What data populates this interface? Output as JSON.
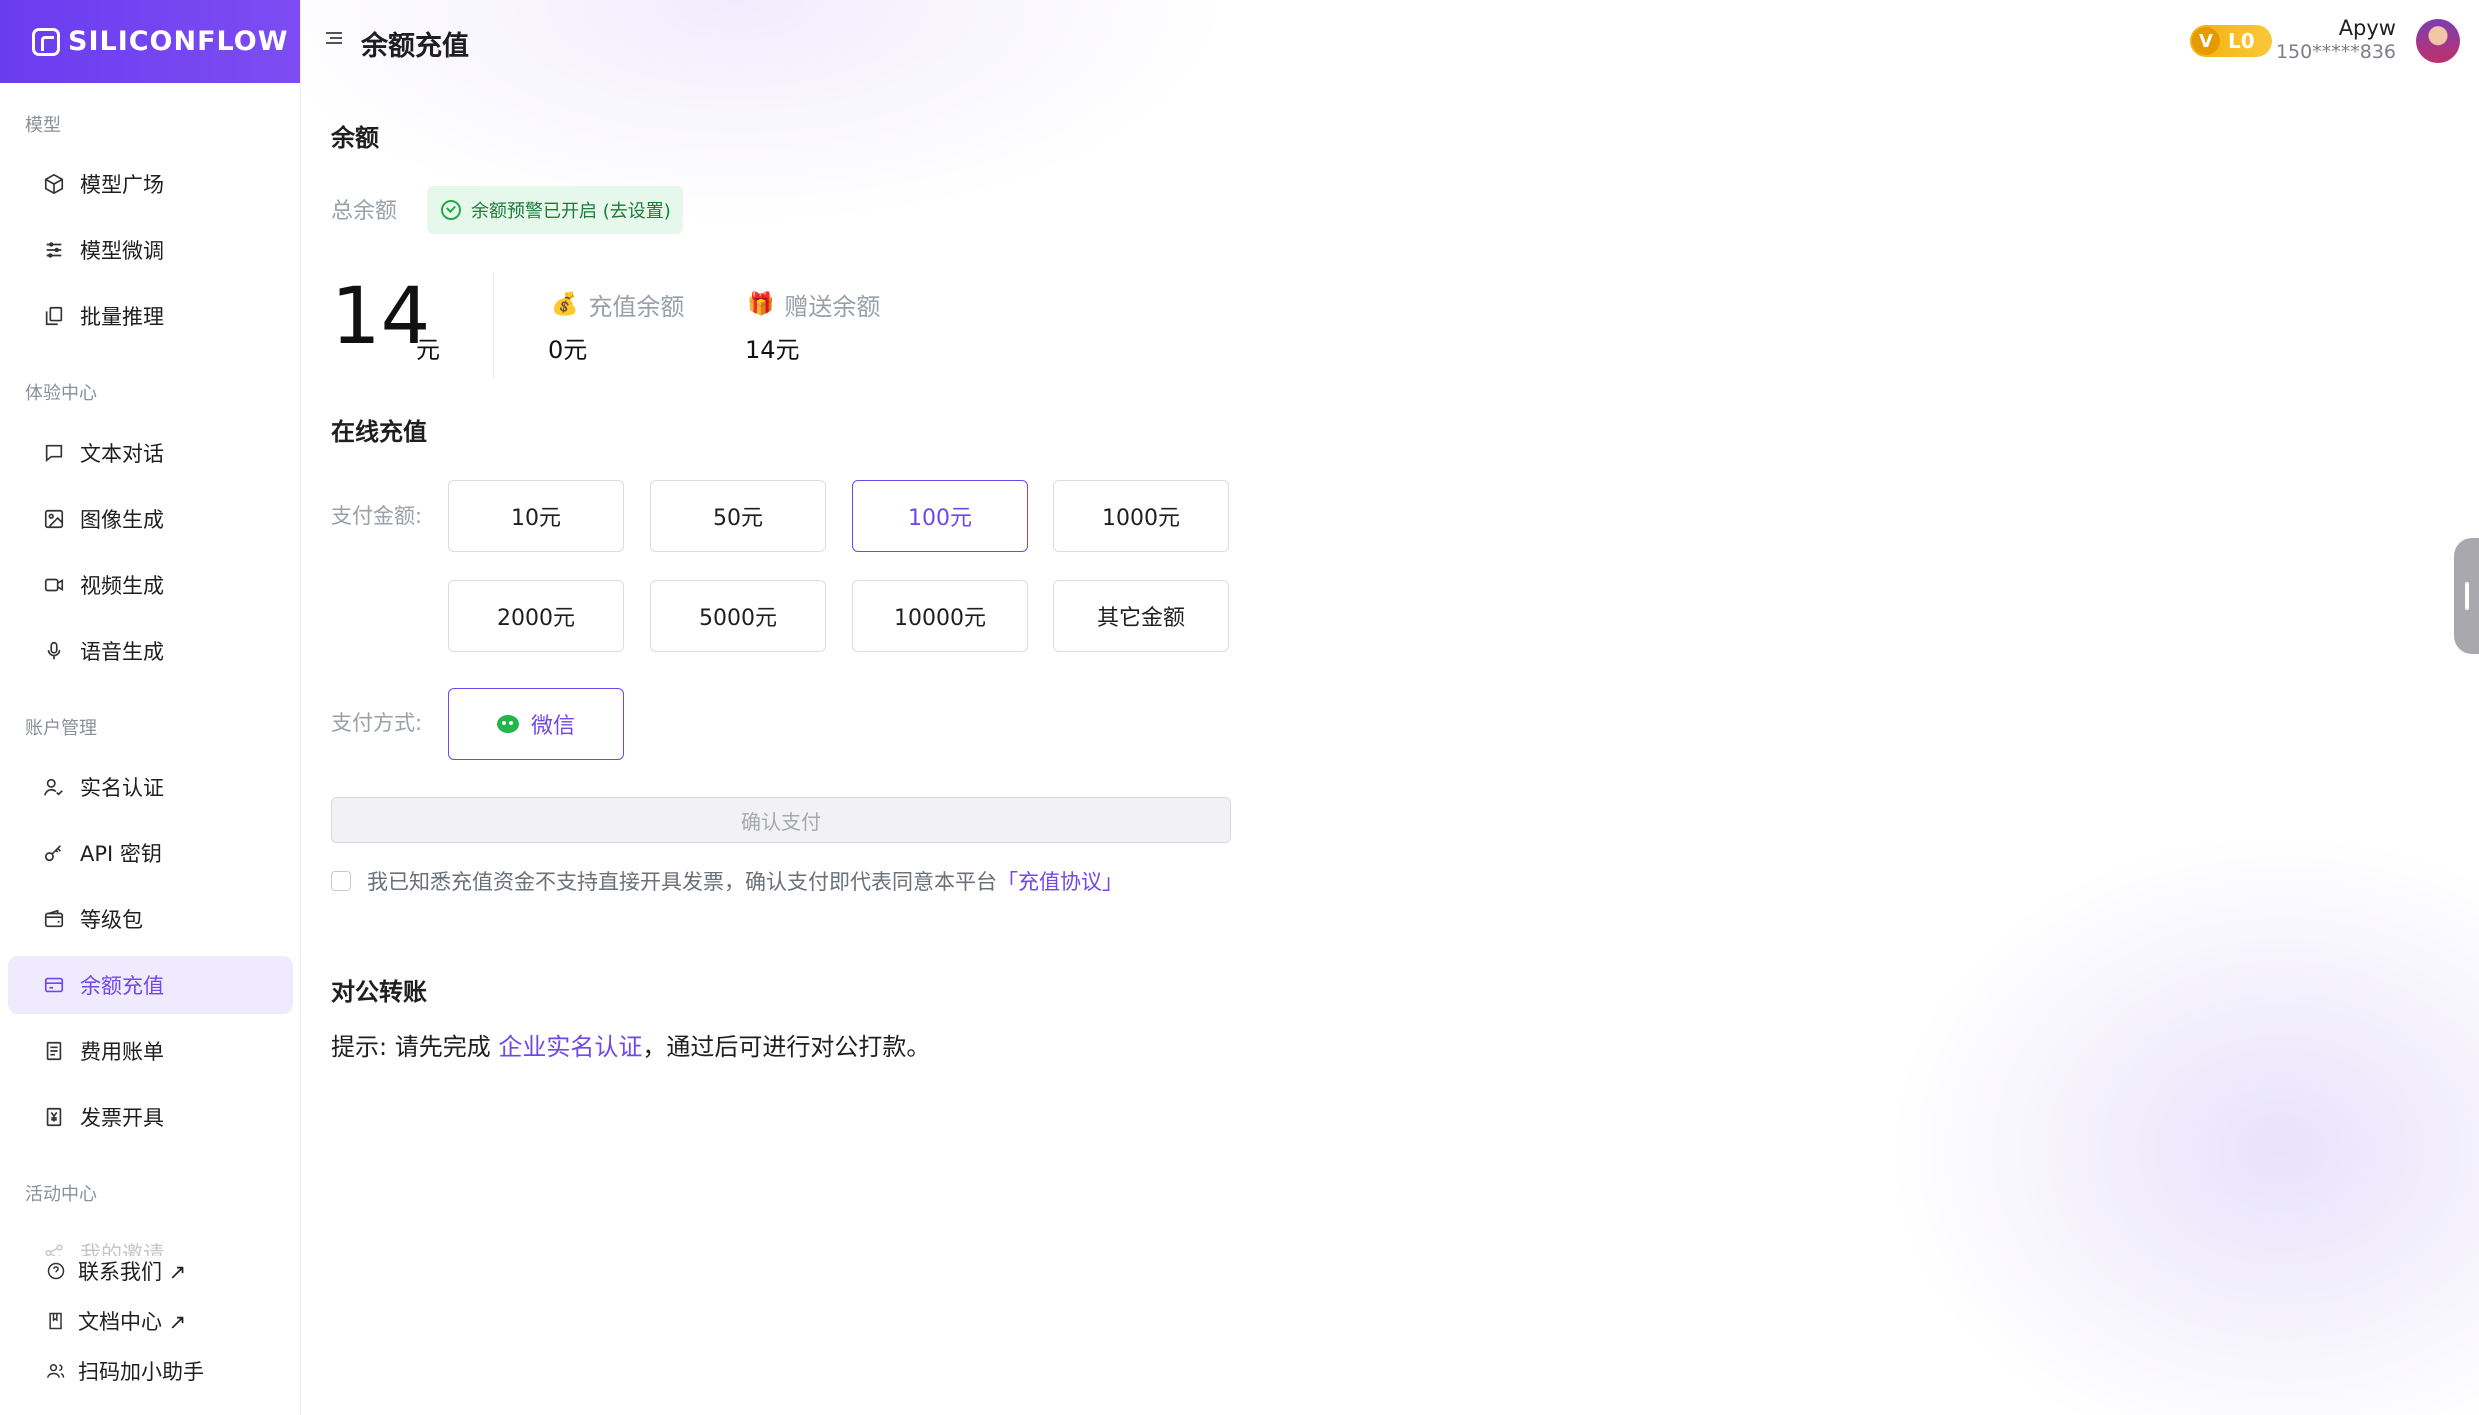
{
  "sidebar": {
    "logo_text": "SILICONFLOW",
    "sections": {
      "model": "模型",
      "experience": "体验中心",
      "account": "账户管理",
      "activity": "活动中心"
    },
    "items": {
      "model_square": "模型广场",
      "model_finetune": "模型微调",
      "batch_inference": "批量推理",
      "text_chat": "文本对话",
      "image_gen": "图像生成",
      "video_gen": "视频生成",
      "voice_gen": "语音生成",
      "realname": "实名认证",
      "api_key": "API 密钥",
      "level_pack": "等级包",
      "recharge": "余额充值",
      "billing": "费用账单",
      "invoice": "发票开具",
      "my_invite": "我的邀请"
    },
    "bottom": {
      "contact": "联系我们 ↗",
      "docs": "文档中心 ↗",
      "assistant": "扫码加小助手"
    }
  },
  "header": {
    "title": "余额充值",
    "badge_icon": "V",
    "level": "L0",
    "username": "Apyw",
    "phone": "150*****836"
  },
  "balance": {
    "section_title": "余额",
    "total_label": "总余额",
    "alert_text": "余额预警已开启 (去设置)",
    "total_value": "14",
    "total_unit": "元",
    "recharge_label": "充值余额",
    "recharge_value": "0元",
    "gift_label": "赠送余额",
    "gift_value": "14元"
  },
  "online": {
    "section_title": "在线充值",
    "amount_label": "支付金额:",
    "amounts": [
      "10元",
      "50元",
      "100元",
      "1000元",
      "2000元",
      "5000元",
      "10000元",
      "其它金额"
    ],
    "selected_amount": "100元",
    "method_label": "支付方式:",
    "method": "微信",
    "confirm": "确认支付",
    "agree_text": "我已知悉充值资金不支持直接开具发票，确认支付即代表同意本平台",
    "agree_link": "「充值协议」"
  },
  "corporate": {
    "section_title": "对公转账",
    "tip_prefix": "提示: 请先完成 ",
    "tip_link": "企业实名认证",
    "tip_suffix": "，通过后可进行对公打款。"
  },
  "colors": {
    "brand": "#7048e8",
    "level_badge": "#f5b10a",
    "success": "#2ba84a"
  }
}
